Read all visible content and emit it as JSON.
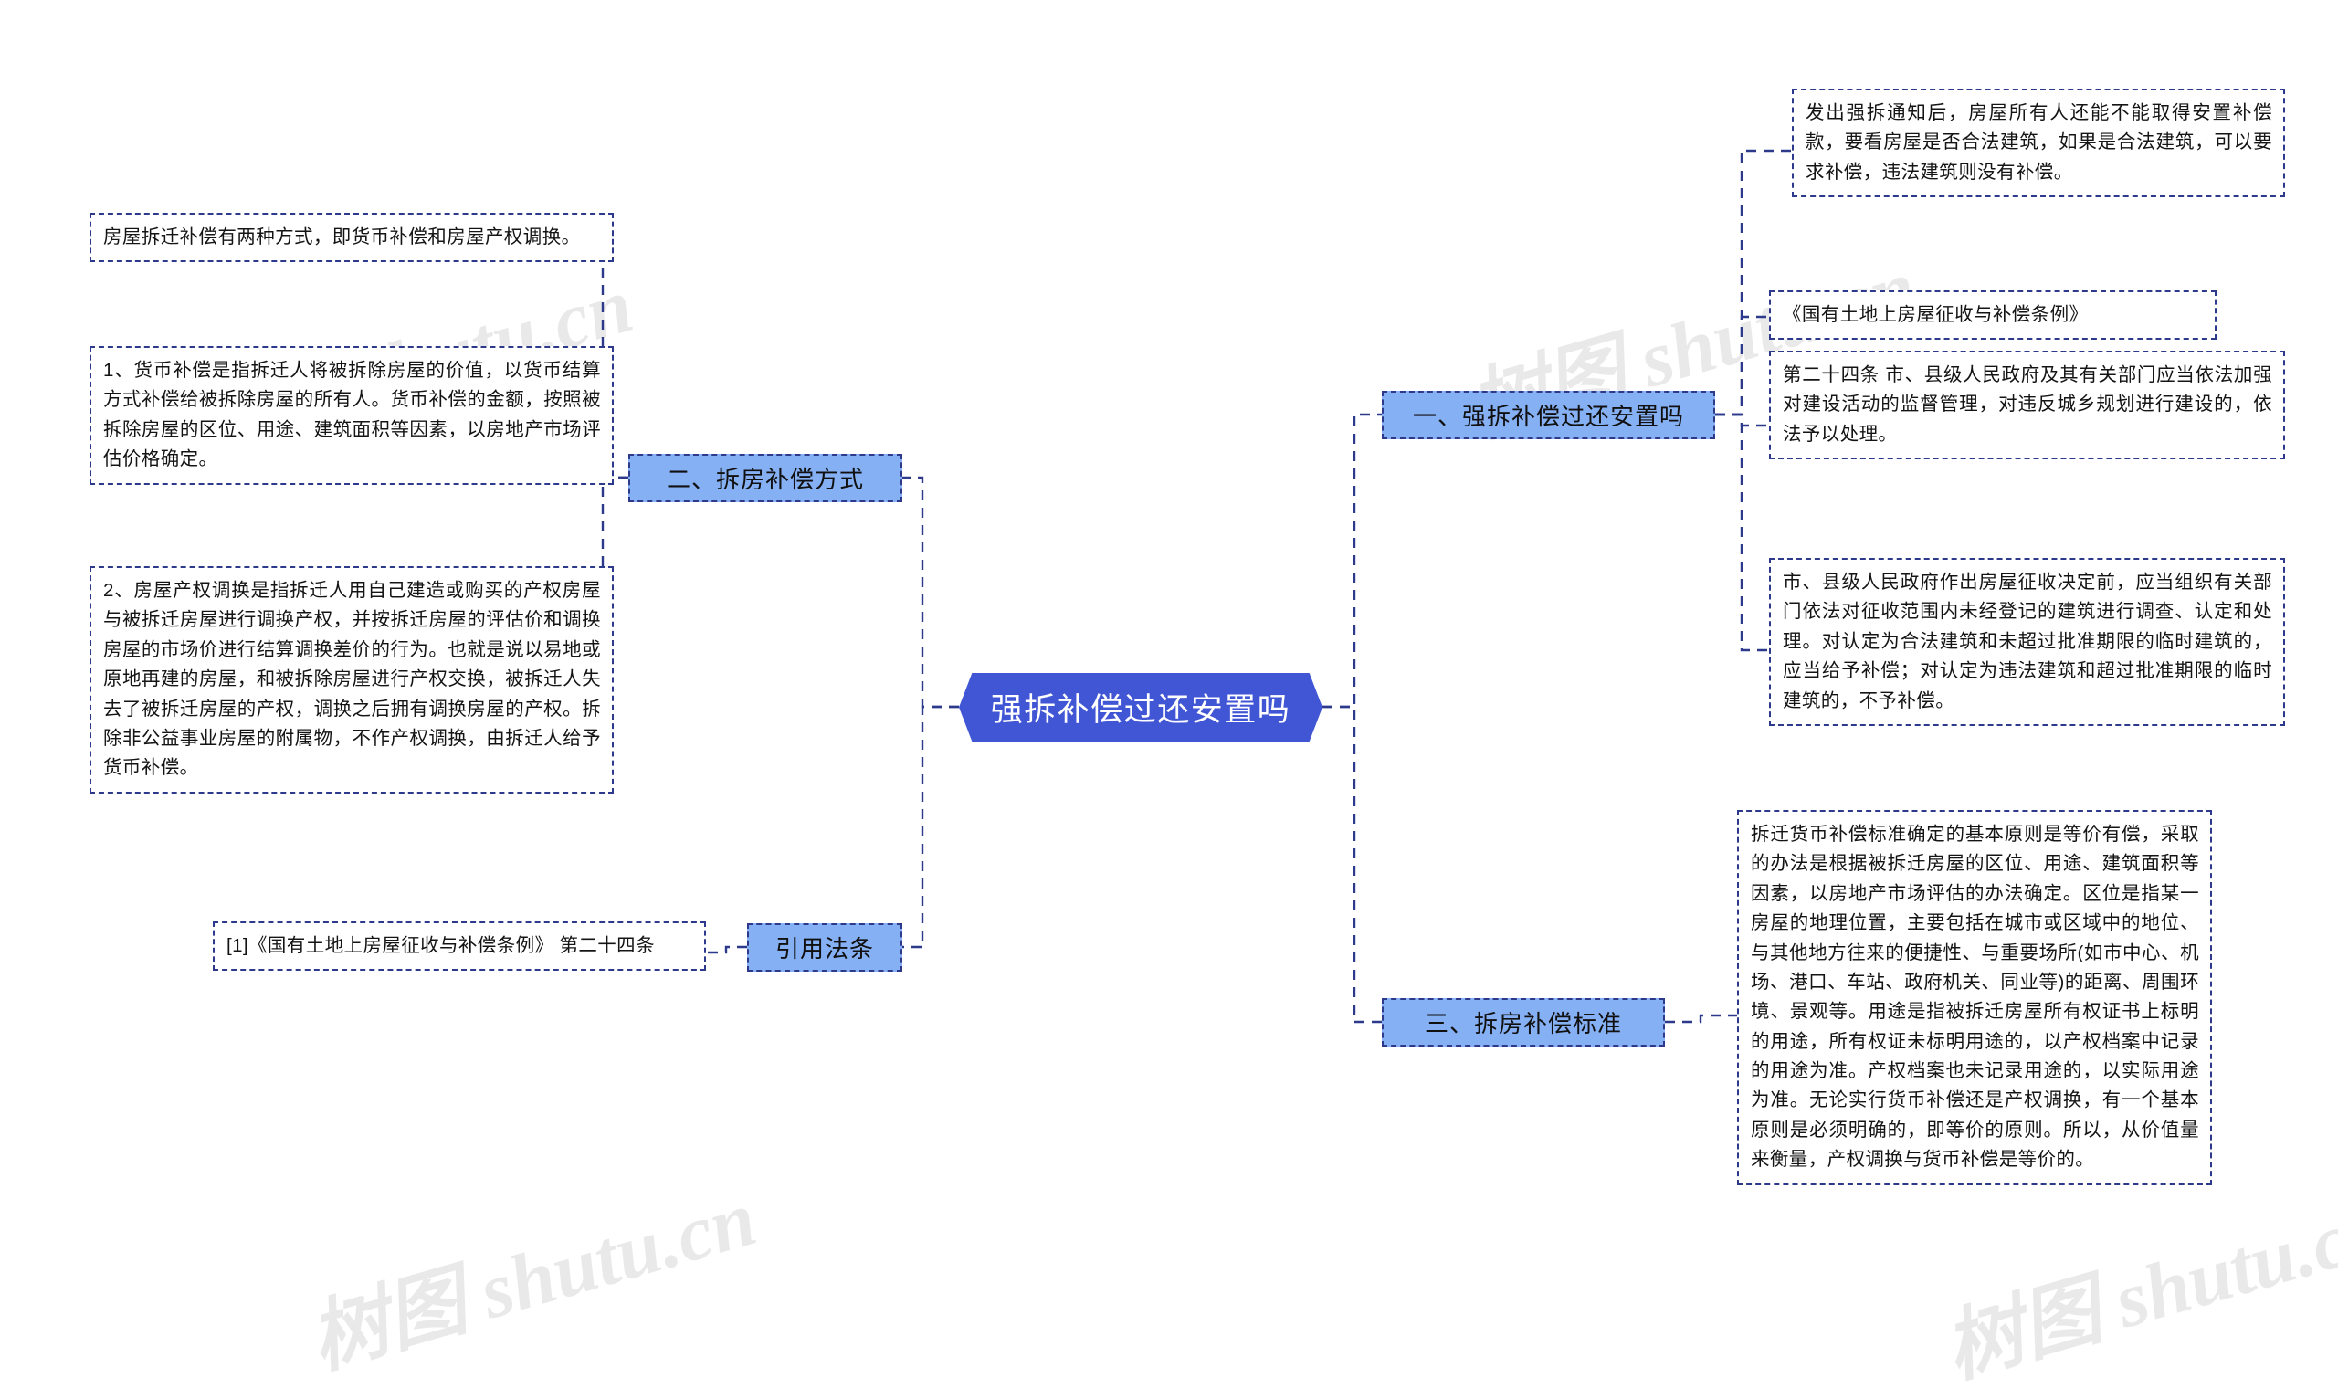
{
  "central": {
    "label": "强拆补偿过还安置吗",
    "color": "#4156d4"
  },
  "theme": {
    "node_fill": "#86b0f4",
    "border": "#2d3a8c"
  },
  "watermarks": {
    "w1": "树图 shutu.cn",
    "w2": "树图 shutu.cn",
    "w3": "树图 shutu.cn",
    "w4": "树图 shutu.cn"
  },
  "left_branch": {
    "nodes": [
      {
        "label": "二、拆房补偿方式"
      },
      {
        "label": "引用法条"
      }
    ],
    "boxes": [
      {
        "text": "房屋拆迁补偿有两种方式，即货币补偿和房屋产权调换。"
      },
      {
        "text": "1、货币补偿是指拆迁人将被拆除房屋的价值，以货币结算方式补偿给被拆除房屋的所有人。货币补偿的金额，按照被拆除房屋的区位、用途、建筑面积等因素，以房地产市场评估价格确定。"
      },
      {
        "text": "2、房屋产权调换是指拆迁人用自己建造或购买的产权房屋与被拆迁房屋进行调换产权，并按拆迁房屋的评估价和调换房屋的市场价进行结算调换差价的行为。也就是说以易地或原地再建的房屋，和被拆除房屋进行产权交换，被拆迁人失去了被拆迁房屋的产权，调换之后拥有调换房屋的产权。拆除非公益事业房屋的附属物，不作产权调换，由拆迁人给予货币补偿。"
      },
      {
        "text": "[1]《国有土地上房屋征收与补偿条例》 第二十四条"
      }
    ]
  },
  "right_branch": {
    "nodes": [
      {
        "label": "一、强拆补偿过还安置吗"
      },
      {
        "label": "三、拆房补偿标准"
      }
    ],
    "boxes": [
      {
        "text": "发出强拆通知后，房屋所有人还能不能取得安置补偿款，要看房屋是否合法建筑，如果是合法建筑，可以要求补偿，违法建筑则没有补偿。"
      },
      {
        "text": "《国有土地上房屋征收与补偿条例》"
      },
      {
        "text": "第二十四条 市、县级人民政府及其有关部门应当依法加强对建设活动的监督管理，对违反城乡规划进行建设的，依法予以处理。"
      },
      {
        "text": "市、县级人民政府作出房屋征收决定前，应当组织有关部门依法对征收范围内未经登记的建筑进行调查、认定和处理。对认定为合法建筑和未超过批准期限的临时建筑的，应当给予补偿；对认定为违法建筑和超过批准期限的临时建筑的，不予补偿。"
      },
      {
        "text": "拆迁货币补偿标准确定的基本原则是等价有偿，采取的办法是根据被拆迁房屋的区位、用途、建筑面积等因素，以房地产市场评估的办法确定。区位是指某一房屋的地理位置，主要包括在城市或区域中的地位、与其他地方往来的便捷性、与重要场所(如市中心、机场、港口、车站、政府机关、同业等)的距离、周围环境、景观等。用途是指被拆迁房屋所有权证书上标明的用途，所有权证未标明用途的，以产权档案中记录的用途为准。产权档案也未记录用途的，以实际用途为准。无论实行货币补偿还是产权调换，有一个基本原则是必须明确的，即等价的原则。所以，从价值量来衡量，产权调换与货币补偿是等价的。"
      }
    ]
  }
}
